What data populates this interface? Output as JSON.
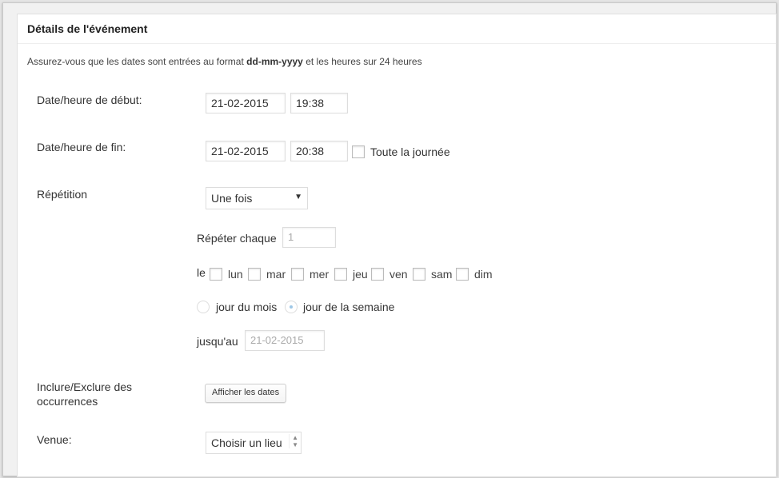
{
  "panel": {
    "title": "Détails de l'événement",
    "note_prefix": "Assurez-vous que les dates sont entrées au format",
    "note_format": "dd-mm-yyyy",
    "note_suffix": "et les heures sur 24 heures"
  },
  "start": {
    "label": "Date/heure de début:",
    "date": "21-02-2015",
    "time": "19:38"
  },
  "end": {
    "label": "Date/heure de fin:",
    "date": "21-02-2015",
    "time": "20:38",
    "allday_label": "Toute la journée",
    "allday_checked": false
  },
  "recurrence": {
    "label": "Répétition",
    "selected": "Une fois",
    "repeat_label": "Répéter chaque",
    "repeat_value": "1",
    "on_label": "le",
    "days": [
      "lun",
      "mar",
      "mer",
      "jeu",
      "ven",
      "sam",
      "dim"
    ],
    "day_of_month_label": "jour du mois",
    "day_of_week_label": "jour de la semaine",
    "day_of_week_selected": true,
    "until_label": "jusqu'au",
    "until_value": "21-02-2015"
  },
  "occurrences": {
    "label_line1": "Inclure/Exclure des",
    "label_line2": "occurrences",
    "button": "Afficher les dates"
  },
  "venue": {
    "label": "Venue:",
    "selected": "Choisir un lieu"
  }
}
